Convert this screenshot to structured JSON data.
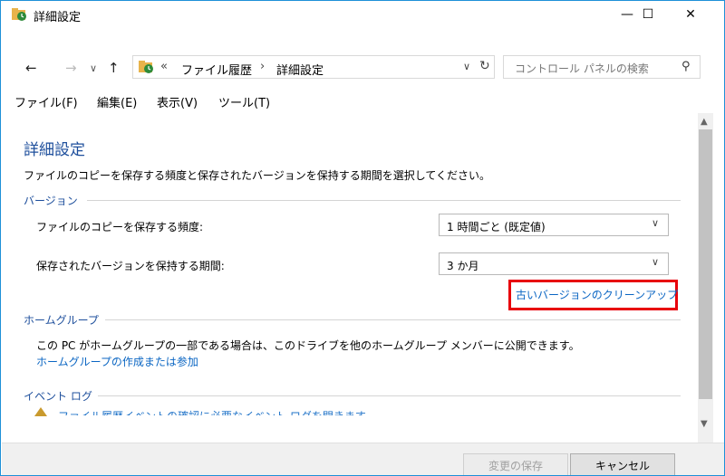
{
  "window": {
    "title": "詳細設定"
  },
  "titlebar": {
    "minimize": "—",
    "maximize": "☐",
    "close": "✕"
  },
  "nav": {
    "back": "←",
    "forward": "→",
    "recent": "∨",
    "up": "↑",
    "address_chevron": "«",
    "crumbs": [
      "ファイル履歴",
      "詳細設定"
    ],
    "crumb_sep": "›",
    "dropdown": "∨",
    "refresh": "↻",
    "search_placeholder": "コントロール パネルの検索",
    "search_icon": "⚲"
  },
  "menu": [
    "ファイル(F)",
    "編集(E)",
    "表示(V)",
    "ツール(T)"
  ],
  "page": {
    "title": "詳細設定",
    "description": "ファイルのコピーを保存する頻度と保存されたバージョンを保持する期間を選択してください。",
    "versions": {
      "heading": "バージョン",
      "frequency_label": "ファイルのコピーを保存する頻度:",
      "frequency_value": "1 時間ごと (既定値)",
      "retention_label": "保存されたバージョンを保持する期間:",
      "retention_value": "3 か月",
      "cleanup_link": "古いバージョンのクリーンアップ"
    },
    "homegroup": {
      "heading": "ホームグループ",
      "text": "この PC がホームグループの一部である場合は、このドライブを他のホームグループ メンバーに公開できます。",
      "link": "ホームグループの作成または参加"
    },
    "eventlog": {
      "heading": "イベント ログ",
      "partial": "ファイル履歴イベントの確認に必要なイベント ログを開きます"
    }
  },
  "footer": {
    "save": "変更の保存",
    "cancel": "キャンセル"
  },
  "colors": {
    "accent": "#1e4f9c",
    "link": "#0b66c3",
    "highlight": "#e8000b"
  }
}
